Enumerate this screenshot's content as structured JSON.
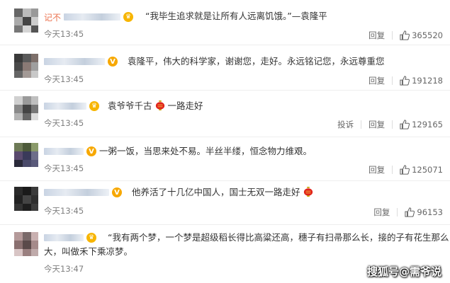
{
  "comments": [
    {
      "name": "记不",
      "badge": "crown",
      "text": "“我毕生追求就是让所有人远离饥饿。”—袁隆平",
      "time": "今天13:45",
      "actions": [
        "回复"
      ],
      "likes": "365520"
    },
    {
      "name": "",
      "badge": "v",
      "text": "袁隆平，伟大的科学家，谢谢您，走好。永远铭记您，永远尊重您",
      "time": "今天13:45",
      "actions": [
        "回复"
      ],
      "likes": "191218"
    },
    {
      "name": "",
      "badge": "crown",
      "text_before": "袁爷爷千古",
      "text_after": "一路走好",
      "time": "今天13:45",
      "actions": [
        "投诉",
        "回复"
      ],
      "likes": "129165"
    },
    {
      "name": "",
      "badge": "v",
      "text": "一粥一饭，当思来处不易。半丝半缕，恒念物力维艰。",
      "time": "今天13:45",
      "actions": [
        "回复"
      ],
      "likes": "125071"
    },
    {
      "name": "",
      "badge": "v",
      "text_before": "他养活了十几亿中国人，国士无双一路走好",
      "time": "今天13:45",
      "actions": [
        "回复"
      ],
      "likes": "96153"
    },
    {
      "name": "",
      "badge": "crown",
      "text_line1": "“我有两个梦，一个梦是超级稻长得比高粱还高，穗子有扫帚那么长，接的子有花生那么",
      "text_line2": "大，叫做禾下乘凉梦。",
      "time": "今天13:47",
      "actions": [],
      "likes": ""
    }
  ],
  "watermark": "搜狐号@需爷说",
  "icons": {
    "like": "thumbs-up-icon",
    "badge_crown": "crown-badge-icon",
    "badge_v": "v-badge-icon",
    "emoji": "lantern-emoji-icon"
  },
  "colors": {
    "name": "#eb7350",
    "time": "#808080",
    "badge": "#f7b500"
  }
}
